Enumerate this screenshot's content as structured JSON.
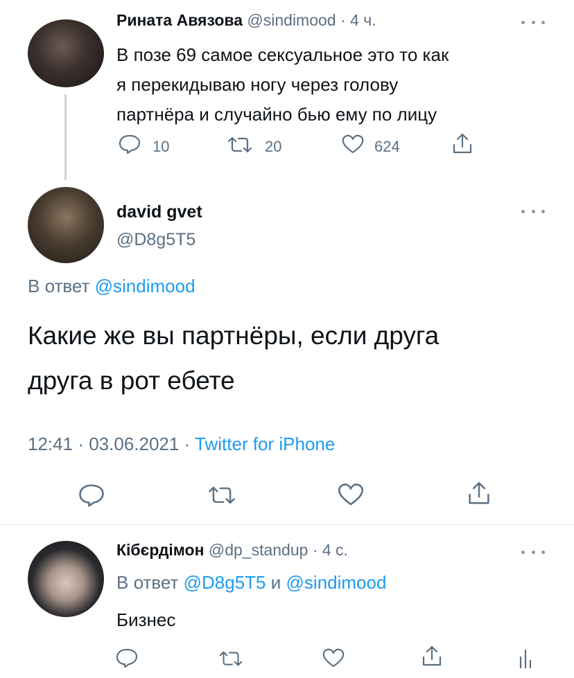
{
  "parent_tweet": {
    "display_name": "Рината Авязова",
    "handle": "@sindimood",
    "time": "· 4 ч.",
    "text_lines": [
      "В позе 69 самое сексуальное это то как",
      "я перекидываю ногу через голову",
      "партнёра и случайно бью ему по лицу"
    ],
    "replies": "10",
    "retweets": "20",
    "likes": "624"
  },
  "main_tweet": {
    "display_name": "david gvet",
    "handle": "@D8g5T5",
    "reply_prefix": "В ответ",
    "reply_to": "@sindimood",
    "text_lines": [
      "Какие же вы партнёры, если друга",
      "друга в рот ебете"
    ],
    "time": "12:41",
    "date": "03.06.2021",
    "source": "Twitter for iPhone",
    "separator": "·"
  },
  "reply_tweet": {
    "display_name": "Кібєрдімон",
    "handle": "@dp_standup",
    "time": "· 4 с.",
    "reply_prefix": "В ответ",
    "reply_to_1": "@D8g5T5",
    "reply_and": "и",
    "reply_to_2": "@sindimood",
    "text": "Бизнес"
  },
  "colors": {
    "link": "#1d9bf0",
    "secondary_text": "#5b7083",
    "divider": "#dfe3e7"
  },
  "icons": [
    "reply-icon",
    "retweet-icon",
    "like-icon",
    "share-icon",
    "analytics-icon",
    "more-icon"
  ]
}
